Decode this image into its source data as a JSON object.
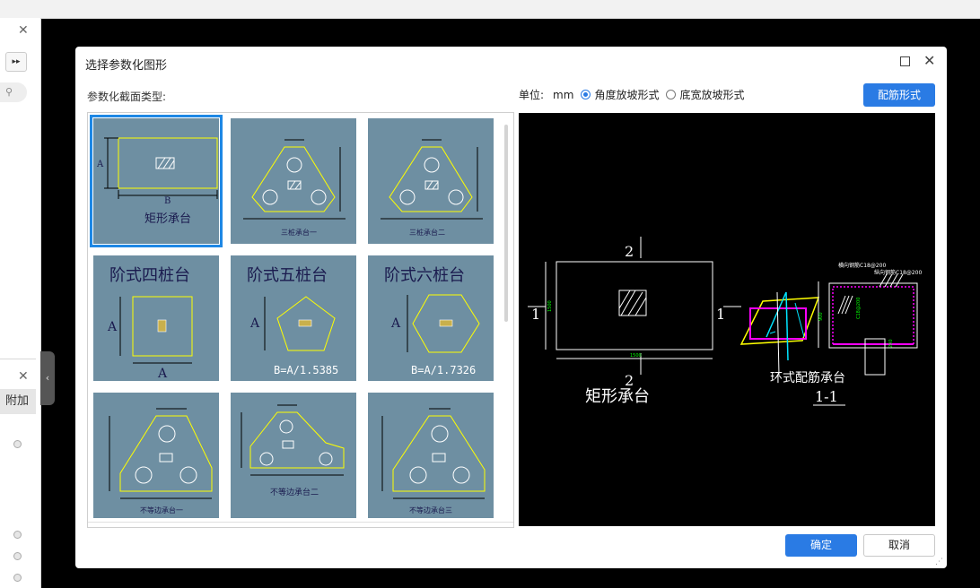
{
  "dialog": {
    "title": "选择参数化图形",
    "section_label": "参数化截面类型:",
    "unit_label": "单位:",
    "unit_value": "mm",
    "radio_angle": "角度放坡形式",
    "radio_width": "底宽放坡形式",
    "rebar_button": "配筋形式",
    "ok_button": "确定",
    "cancel_button": "取消"
  },
  "left_panel": {
    "tab_label": "附加",
    "close_glyph": "✕",
    "expand_glyph": "▸▸"
  },
  "shapes": [
    {
      "title": "矩形承台",
      "dim_a": "A",
      "dim_b": "B"
    },
    {
      "title": "三桩承台一"
    },
    {
      "title": "三桩承台二"
    },
    {
      "title": "阶式四桩台",
      "dim_a": "A",
      "dim_b": "A"
    },
    {
      "title": "阶式五桩台",
      "dim_a": "A",
      "formula": "B=A/1.5385"
    },
    {
      "title": "阶式六桩台",
      "dim_a": "A",
      "formula": "B=A/1.7326"
    },
    {
      "title": "不等边承台一"
    },
    {
      "title": "不等边承台二"
    },
    {
      "title": "不等边承台三"
    }
  ],
  "preview": {
    "label_2": "2",
    "label_1": "1",
    "dim_h": "1500",
    "dim_w": "1500",
    "dim_s": "900",
    "main_caption": "矩形承台",
    "ring_caption": "环式配筋承台",
    "section_caption": "1-1",
    "rebar_note_1": "横向钢筋C18@200",
    "rebar_note_2": "纵向钢筋C18@200",
    "rebar_note_3": "C18@200",
    "small_dim": "200"
  },
  "colors": {
    "accent": "#2a7be4",
    "cell_bg": "#6e8fa2",
    "cad_yellow": "#ffff00",
    "cad_magenta": "#ff00ff",
    "cad_cyan": "#00e5ff"
  }
}
